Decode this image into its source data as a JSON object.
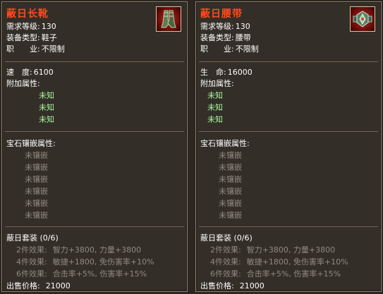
{
  "left": {
    "name": "蔽日长靴",
    "icon": "boots-icon",
    "req_level_label": "需求等级:",
    "req_level": "130",
    "equip_type_label": "装备类型:",
    "equip_type": "鞋子",
    "class_label": "职　　业:",
    "class_value": "不限制",
    "stat_label": "速　度:",
    "stat_value": "6100",
    "extra_label": "附加属性:",
    "extra": [
      "未知",
      "未知",
      "未知"
    ],
    "gem_label": "宝石镶嵌属性:",
    "gems": [
      "未镶嵌",
      "未镶嵌",
      "未镶嵌",
      "未镶嵌",
      "未镶嵌",
      "未镶嵌"
    ],
    "set_label": "蔽日套装 (0/6)",
    "set_effects": [
      {
        "label": "2件效果:",
        "value": "智力+3800, 力量+3800"
      },
      {
        "label": "4件效果:",
        "value": "敏捷+1800, 免伤害率+10%"
      },
      {
        "label": "6件效果:",
        "value": "合击率+5%, 伤害率+15%"
      }
    ],
    "price_label": "出售价格:",
    "price": "21000"
  },
  "right": {
    "name": "蔽日腰带",
    "icon": "belt-icon",
    "req_level_label": "需求等级:",
    "req_level": "130",
    "equip_type_label": "装备类型:",
    "equip_type": "腰带",
    "class_label": "职　　业:",
    "class_value": "不限制",
    "stat_label": "生　命:",
    "stat_value": "16000",
    "extra_label": "附加属性:",
    "extra": [
      "未知",
      "未知",
      "未知"
    ],
    "gem_label": "宝石镶嵌属性:",
    "gems": [
      "未镶嵌",
      "未镶嵌",
      "未镶嵌",
      "未镶嵌",
      "未镶嵌",
      "未镶嵌"
    ],
    "set_label": "蔽日套装 (0/6)",
    "set_effects": [
      {
        "label": "2件效果:",
        "value": "智力+3800, 力量+3800"
      },
      {
        "label": "4件效果:",
        "value": "敏捷+1800, 免伤害率+10%"
      },
      {
        "label": "6件效果:",
        "value": "合击率+5%, 伤害率+15%"
      }
    ],
    "price_label": "出售价格:",
    "price": "21000"
  },
  "colors": {
    "title": "#ff4a1e",
    "unknown_attr": "#a9f7a0",
    "muted": "#8f8a80",
    "text": "#ffffff"
  }
}
